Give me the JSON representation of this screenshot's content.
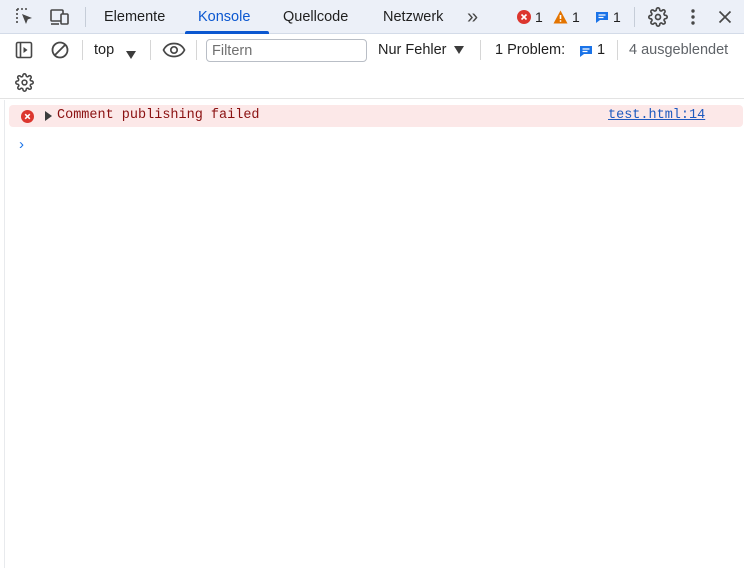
{
  "tabs": [
    {
      "label": "Elemente",
      "active": false
    },
    {
      "label": "Konsole",
      "active": true
    },
    {
      "label": "Quellcode",
      "active": false
    },
    {
      "label": "Netzwerk",
      "active": false
    }
  ],
  "more_tabs": "»",
  "counters": {
    "errors": "1",
    "warnings": "1",
    "info": "1"
  },
  "toolbar": {
    "context": "top",
    "filter_placeholder": "Filtern",
    "filter_value": "",
    "level": "Nur Fehler",
    "problems_label": "1 Problem:",
    "problems_count": "1",
    "hidden": "4 ausgeblendet"
  },
  "messages": [
    {
      "level": "error",
      "text": "Comment publishing failed",
      "source": "test.html:14"
    }
  ],
  "prompt_symbol": "›",
  "colors": {
    "accent": "#0b57d0",
    "error": "#dc362e",
    "warning": "#e37400",
    "info": "#1a73e8",
    "error_row_bg": "#fce8e8",
    "tabbar_bg": "#ecf0f8"
  },
  "icons": [
    "inspect-element-icon",
    "device-toolbar-icon",
    "more-tabs-icon",
    "error-icon",
    "warning-icon",
    "info-icon",
    "settings-icon",
    "kebab-menu-icon",
    "close-icon",
    "sidebar-toggle-icon",
    "clear-console-icon",
    "dropdown-arrow-icon",
    "eye-icon",
    "console-settings-icon",
    "expand-triangle-icon"
  ]
}
